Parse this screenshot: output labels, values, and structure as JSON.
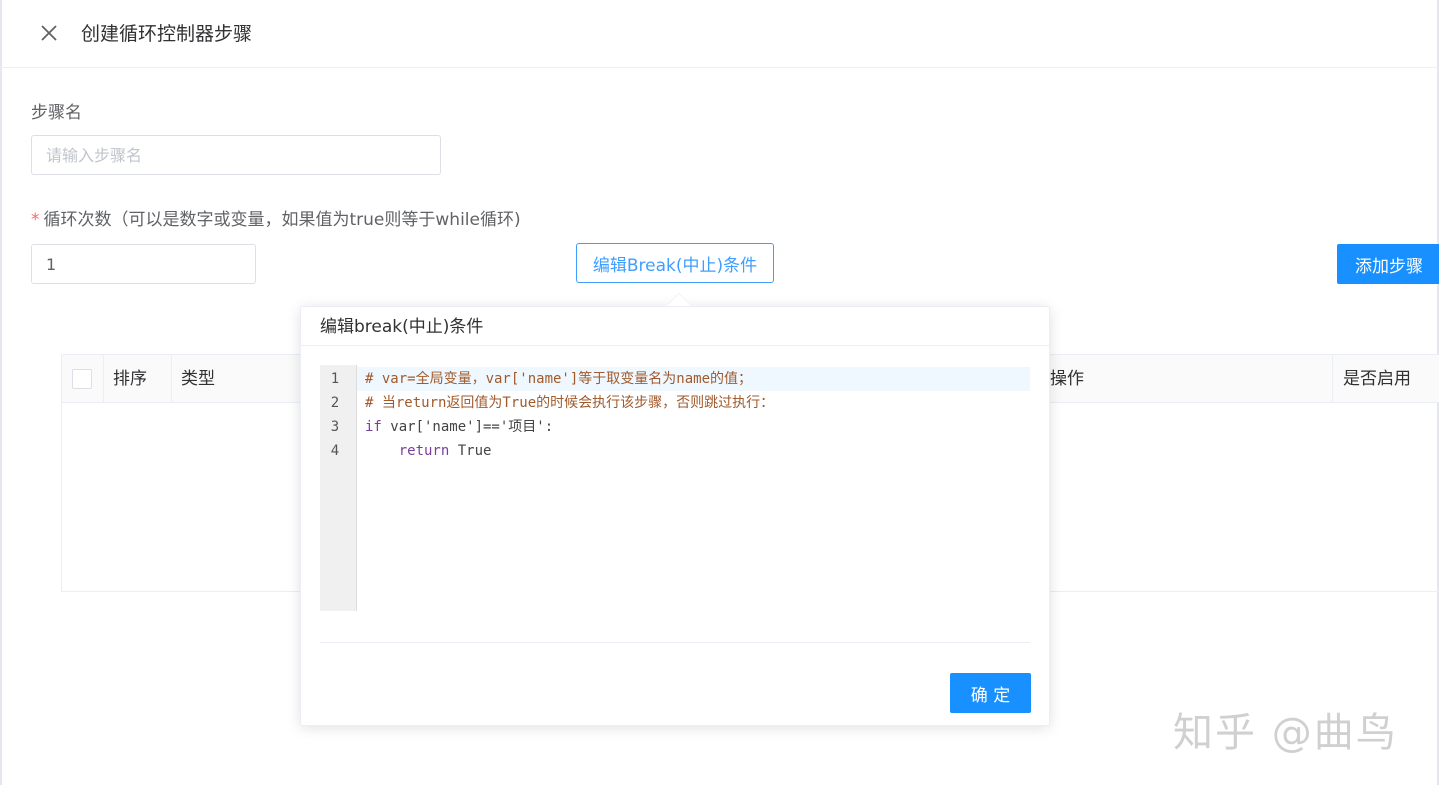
{
  "header": {
    "title": "创建循环控制器步骤",
    "close_icon": "close-icon"
  },
  "form": {
    "step_name": {
      "label": "步骤名",
      "placeholder": "请输入步骤名",
      "value": ""
    },
    "loop_count": {
      "required_mark": "*",
      "label": "循环次数（可以是数字或变量，如果值为true则等于while循环)",
      "value": "1"
    },
    "edit_break_button": "编辑Break(中止)条件",
    "add_step_button": "添加步骤"
  },
  "table": {
    "columns": [
      "排序",
      "类型",
      "操作",
      "是否启用"
    ],
    "rows": []
  },
  "popover": {
    "title": "编辑break(中止)条件",
    "line_numbers": [
      "1",
      "2",
      "3",
      "4"
    ],
    "code": {
      "line1": "# var=全局变量，var['name']等于取变量名为name的值；",
      "line2": "# 当return返回值为True的时候会执行该步骤，否则跳过执行：",
      "line3_kw": "if",
      "line3_rest": " var['name']=='项目':",
      "line4_indent": "    ",
      "line4_kw": "return",
      "line4_rest": " True"
    },
    "confirm_button": "确 定"
  },
  "watermark": "知乎 @曲鸟",
  "colors": {
    "primary": "#1890ff",
    "plain_border": "#409eff",
    "required": "#f56c6c",
    "comment": "#a05a2c",
    "keyword": "#7a3e9d"
  }
}
